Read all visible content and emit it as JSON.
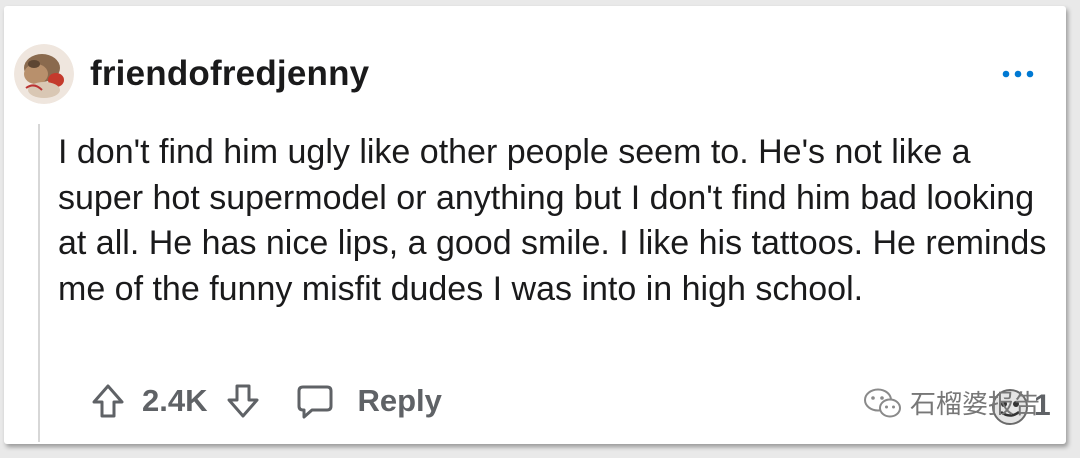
{
  "comment": {
    "username": "friendofredjenny",
    "body": "I don't find him ugly like other people seem to. He's not like a super hot supermodel or anything but I don't find him bad looking at all. He has nice lips, a good smile. I like his tattoos. He reminds me of the funny misfit dudes I was into in high school.",
    "score": "2.4K",
    "reply_label": "Reply",
    "award_count": "1"
  },
  "icons": {
    "avatar": "avatar-image",
    "more": "more-dots-icon",
    "upvote": "upvote-arrow-icon",
    "downvote": "downvote-arrow-icon",
    "reply": "speech-bubble-icon",
    "award": "award-icon",
    "watermark": "wechat-icon"
  },
  "watermark": {
    "text": "石榴婆报告"
  },
  "colors": {
    "accent_blue": "#0079d3",
    "text_dark": "#1a1a1b",
    "text_gray": "#5f6266"
  }
}
